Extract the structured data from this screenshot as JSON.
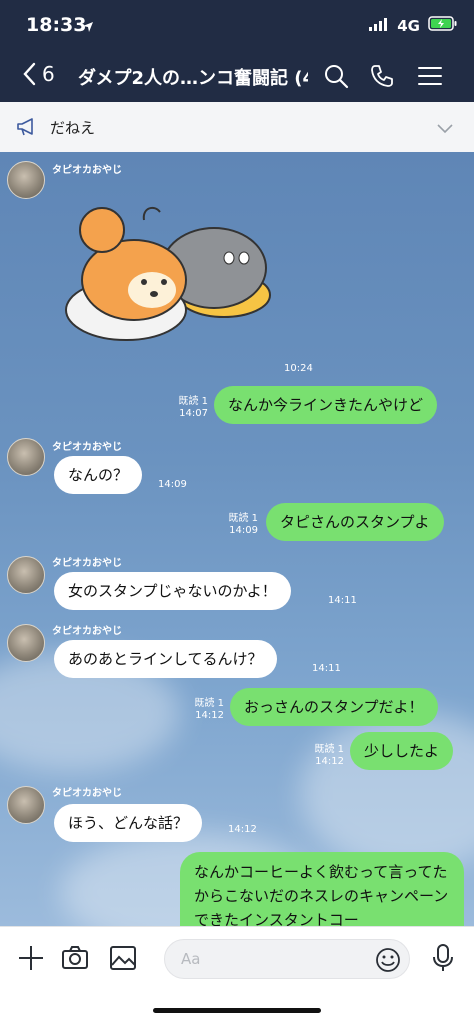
{
  "status_bar": {
    "time": "18:33",
    "network": "4G"
  },
  "header": {
    "back_count": "6",
    "title": "ダメプ2人の…ンコ奮闘記 (4)"
  },
  "announcement": {
    "text": "だねえ"
  },
  "chat": {
    "sender_name": "タピオカおやじ",
    "sticker_time": "10:24",
    "messages": [
      {
        "text": "なんか今ラインきたんやけど",
        "read": "既読 1",
        "time": "14:07"
      },
      {
        "text": "なんの？",
        "time": "14:09"
      },
      {
        "text": "タピさんのスタンプよ",
        "read": "既読 1",
        "time": "14:09"
      },
      {
        "text": "女のスタンプじゃないのかよ！",
        "time": "14:11"
      },
      {
        "text": "あのあとラインしてるんけ？",
        "time": "14:11"
      },
      {
        "text": "おっさんのスタンプだよ！",
        "read": "既読 1",
        "time": "14:12"
      },
      {
        "text": "少ししたよ",
        "read": "既読 1",
        "time": "14:12"
      },
      {
        "text": "ほう、どんな話？",
        "time": "14:12"
      },
      {
        "text": "なんかコーヒーよく飲むって言ってたからこないだのネスレのキャンペーンできたインスタントコー"
      }
    ]
  },
  "input": {
    "placeholder": "Aa"
  },
  "colors": {
    "header_bg": "#212c44",
    "outgoing_bubble": "#79e070",
    "incoming_bubble": "#ffffff",
    "chat_bg": "#6b93c0"
  }
}
